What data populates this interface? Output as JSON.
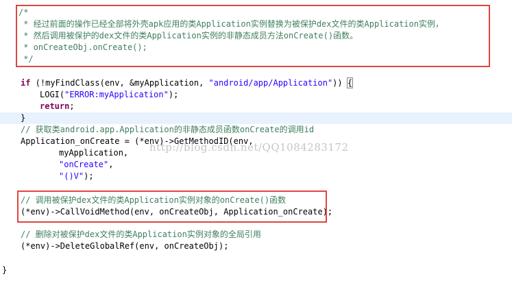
{
  "code": {
    "comment_open": "/*",
    "comment_line1": " * 经过前面的操作已经全部将外壳apk应用的类Application实例替换为被保护dex文件的类Application实例，",
    "comment_line2": " * 然后调用被保护的dex文件的类Application实例的非静态成员方法onCreate()函数。",
    "comment_line3": " * onCreateObj.onCreate();",
    "comment_close": " */",
    "if_kw": "if",
    "if_rest": " (!myFindClass(env, &myApplication, ",
    "if_str": "\"android/app/Application\"",
    "if_tail": ")) ",
    "if_brace": "{",
    "logi_pre": "LOGI(",
    "logi_str": "\"ERROR:myApplication\"",
    "logi_post": ");",
    "return_kw": "return",
    "return_semi": ";",
    "close_brace": "}",
    "comment_get": "// 获取类android.app.Application的非静态成员函数onCreate的调用id",
    "app_oncreate_pre": "Application_onCreate = (*env)->GetMethodID(env,",
    "arg_myapp": "myApplication,",
    "arg_oncreate_str": "\"onCreate\"",
    "arg_oncreate_comma": ",",
    "arg_sig_str": "\"()V\"",
    "arg_sig_end": ");",
    "comment_call": "// 调用被保护dex文件的类Application实例对象的onCreate()函数",
    "call_line": "(*env)->CallVoidMethod(env, onCreateObj, Application_onCreate);",
    "comment_delete": "// 删除对被保护dex文件的类Application实例对象的全局引用",
    "delete_line": "(*env)->DeleteGlobalRef(env, onCreateObj);",
    "final_brace": "}"
  },
  "watermark": "http://blog.csdn.net/QQ1084283172",
  "colors": {
    "comment": "#3f7f5f",
    "keyword": "#7f0055",
    "string": "#2a00ff",
    "highlight_box": "#e0453f",
    "current_line": "#e8f2fe"
  }
}
